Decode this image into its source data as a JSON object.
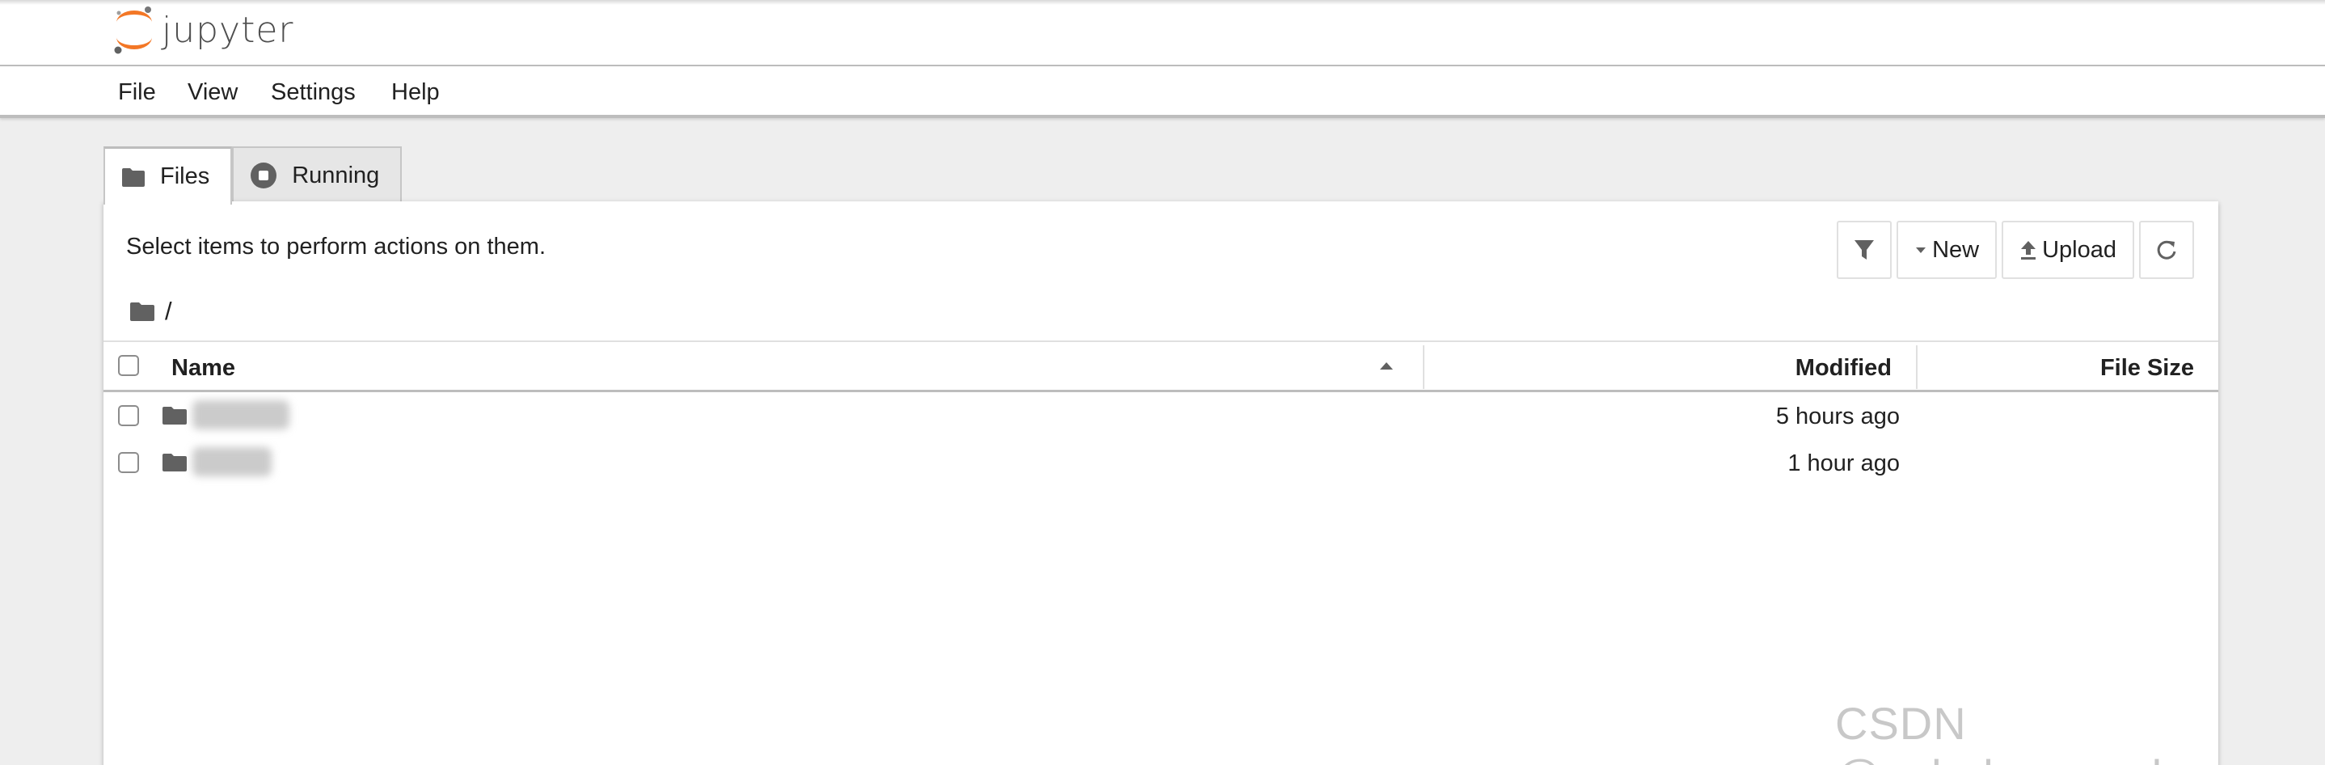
{
  "app": {
    "name": "jupyter",
    "logo_icon": "jupyter-logo",
    "accent": "#f37726"
  },
  "menu": [
    "File",
    "View",
    "Settings",
    "Help"
  ],
  "tabs": [
    {
      "label": "Files",
      "icon": "folder-icon",
      "active": true
    },
    {
      "label": "Running",
      "icon": "stop-circle-icon",
      "active": false
    }
  ],
  "browser": {
    "hint": "Select items to perform actions on them.",
    "toolbar": {
      "filter_icon": "filter-icon",
      "new_label": "New",
      "upload_label": "Upload",
      "refresh_icon": "refresh-icon"
    },
    "breadcrumb": "/",
    "columns": {
      "name": "Name",
      "modified": "Modified",
      "size": "File Size"
    },
    "sort": {
      "column": "Name",
      "direction": "ascending"
    },
    "rows": [
      {
        "type": "folder",
        "modified": "5 hours ago"
      },
      {
        "type": "folder",
        "modified": "1 hour ago"
      }
    ]
  },
  "watermark": "CSDN @echola_mendes"
}
